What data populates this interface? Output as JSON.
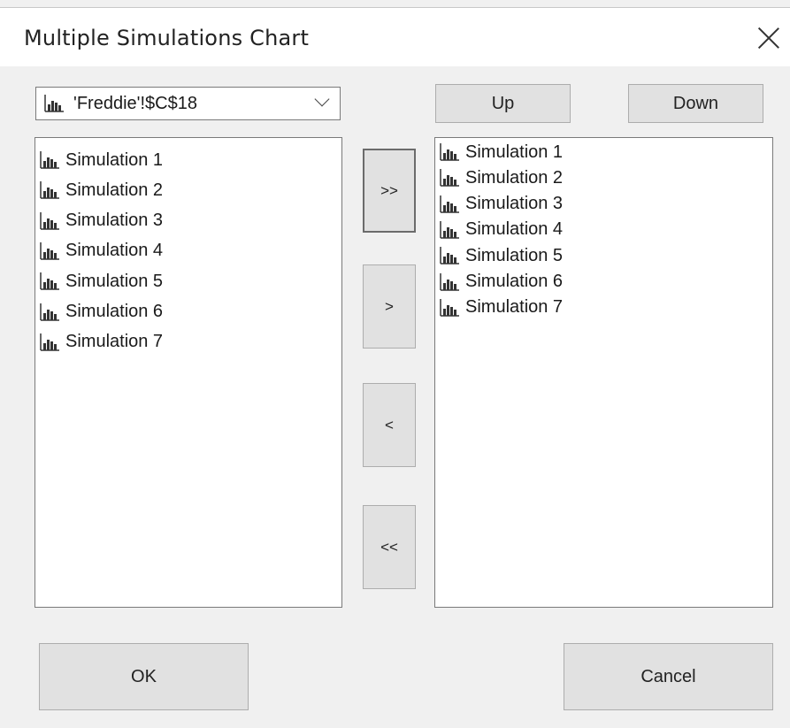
{
  "window": {
    "title": "Multiple Simulations Chart"
  },
  "selector": {
    "value": "'Freddie'!$C$18"
  },
  "available_list": {
    "items": [
      "Simulation 1",
      "Simulation 2",
      "Simulation 3",
      "Simulation 4",
      "Simulation 5",
      "Simulation 6",
      "Simulation 7"
    ]
  },
  "selected_list": {
    "items": [
      "Simulation 1",
      "Simulation 2",
      "Simulation 3",
      "Simulation 4",
      "Simulation 5",
      "Simulation 6",
      "Simulation 7"
    ]
  },
  "buttons": {
    "up": "Up",
    "down": "Down",
    "add_all": ">>",
    "add": ">",
    "remove": "<",
    "remove_all": "<<",
    "ok": "OK",
    "cancel": "Cancel"
  },
  "icons": {
    "item": "chart-icon",
    "close": "close-icon",
    "dropdown": "chevron-down-icon"
  }
}
